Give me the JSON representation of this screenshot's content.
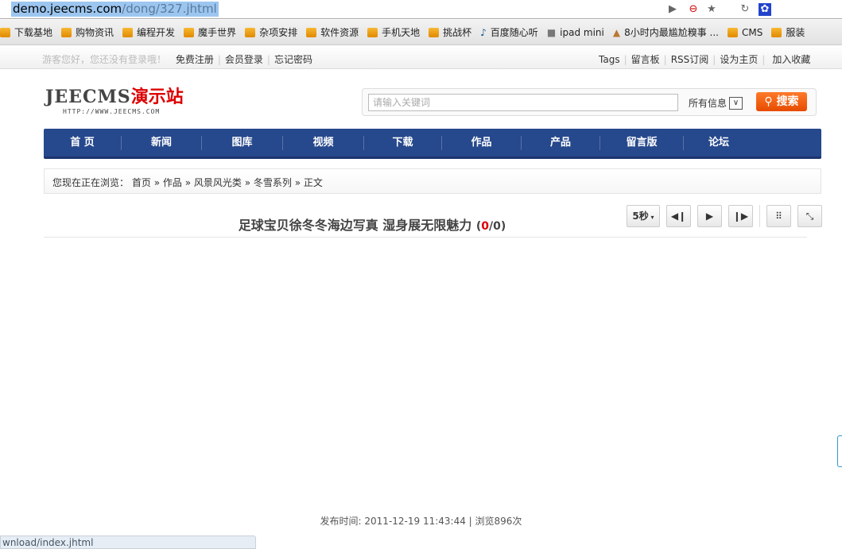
{
  "browser": {
    "url_host": "demo.jeecms.com",
    "url_path": "/dong/327.jhtml",
    "status_url": "wnload/index.jhtml",
    "bookmarks": [
      "下载基地",
      "购物资讯",
      "编程开发",
      "魔手世界",
      "杂项安排",
      "软件资源",
      "手机天地",
      "挑战杯",
      "百度随心听",
      "ipad mini",
      "8小时内最尴尬糗事 ...",
      "CMS",
      "服装"
    ]
  },
  "topbar": {
    "greeting": "游客您好，您还没有登录哦！",
    "register": "免费注册",
    "login": "会员登录",
    "forgot": "忘记密码",
    "right": [
      "Tags",
      "留言板",
      "RSS订阅",
      "设为主页",
      "加入收藏"
    ]
  },
  "logo": {
    "en": "JEECMS",
    "cn": "演示站",
    "sub": "HTTP://WWW.JEECMS.COM"
  },
  "search": {
    "placeholder": "请输入关键词",
    "scope": "所有信息",
    "button": "搜索"
  },
  "nav": [
    "首 页",
    "新闻",
    "图库",
    "视频",
    "下载",
    "作品",
    "产品",
    "留言版",
    "论坛"
  ],
  "breadcrumb": {
    "prefix": "您现在正在浏览：",
    "items": [
      "首页",
      "作品",
      "风景风光类",
      "冬雪系列",
      "正文"
    ],
    "sep": "»"
  },
  "article": {
    "title": "足球宝贝徐冬冬海边写真 湿身展无限魅力",
    "current": "0",
    "total": "0",
    "interval": "5秒",
    "footer": "发布时间: 2011-12-19 11:43:44 | 浏览896次"
  }
}
